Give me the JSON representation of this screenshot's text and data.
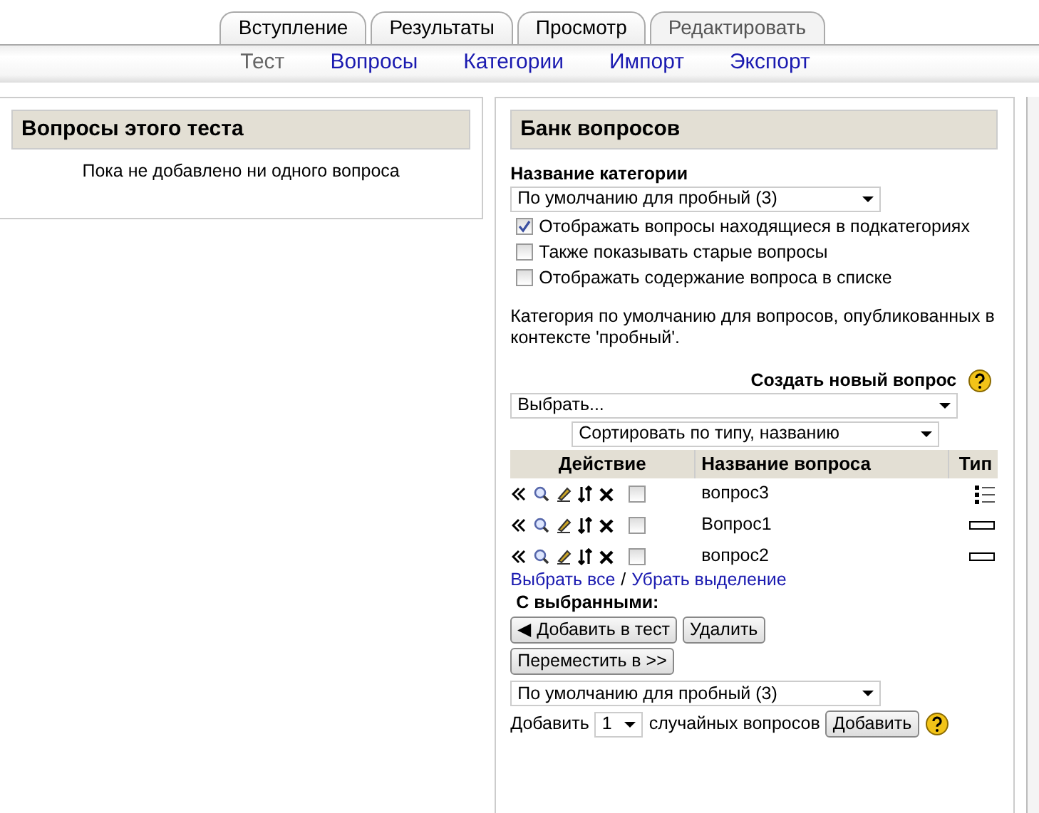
{
  "tabs": [
    {
      "label": "Вступление",
      "selected": false
    },
    {
      "label": "Результаты",
      "selected": false
    },
    {
      "label": "Просмотр",
      "selected": false
    },
    {
      "label": "Редактировать",
      "selected": true
    }
  ],
  "subnav": [
    {
      "label": "Тест",
      "selected": true
    },
    {
      "label": "Вопросы",
      "selected": false
    },
    {
      "label": "Категории",
      "selected": false
    },
    {
      "label": "Импорт",
      "selected": false
    },
    {
      "label": "Экспорт",
      "selected": false
    }
  ],
  "quiz_panel": {
    "title": "Вопросы этого теста",
    "message": "Пока не добавлено ни одного вопроса"
  },
  "bank_panel": {
    "title": "Банк вопросов",
    "category_label": "Название категории",
    "category_value": "По умолчанию для пробный (3)",
    "options": [
      {
        "label": "Отображать вопросы находящиеся в подкатегориях",
        "checked": true
      },
      {
        "label": "Также показывать старые вопросы",
        "checked": false
      },
      {
        "label": "Отображать содержание вопроса в списке",
        "checked": false
      }
    ],
    "category_info": "Категория по умолчанию для вопросов, опубликованных в контексте 'пробный'.",
    "create_label": "Создать новый вопрос",
    "create_value": "Выбрать...",
    "sort_value": "Сортировать по типу, названию",
    "columns": [
      "Действие",
      "Название вопроса",
      "Тип"
    ],
    "rows": [
      {
        "name": "вопрос3",
        "kind": "multichoice",
        "checked": false
      },
      {
        "name": "Вопрос1",
        "kind": "shortanswer",
        "checked": false
      },
      {
        "name": "вопрос2",
        "kind": "shortanswer",
        "checked": false
      }
    ],
    "select_all": "Выбрать все",
    "separator": "/",
    "deselect": "Убрать выделение",
    "with_selected": "С выбранными:",
    "add_button": "◀ Добавить в тест",
    "delete_button": "Удалить",
    "move_button": "Переместить в >>",
    "move_target": "По умолчанию для пробный (3)",
    "random_prefix": "Добавить",
    "random_count": "1",
    "random_suffix": "случайных вопросов",
    "random_button": "Добавить"
  }
}
